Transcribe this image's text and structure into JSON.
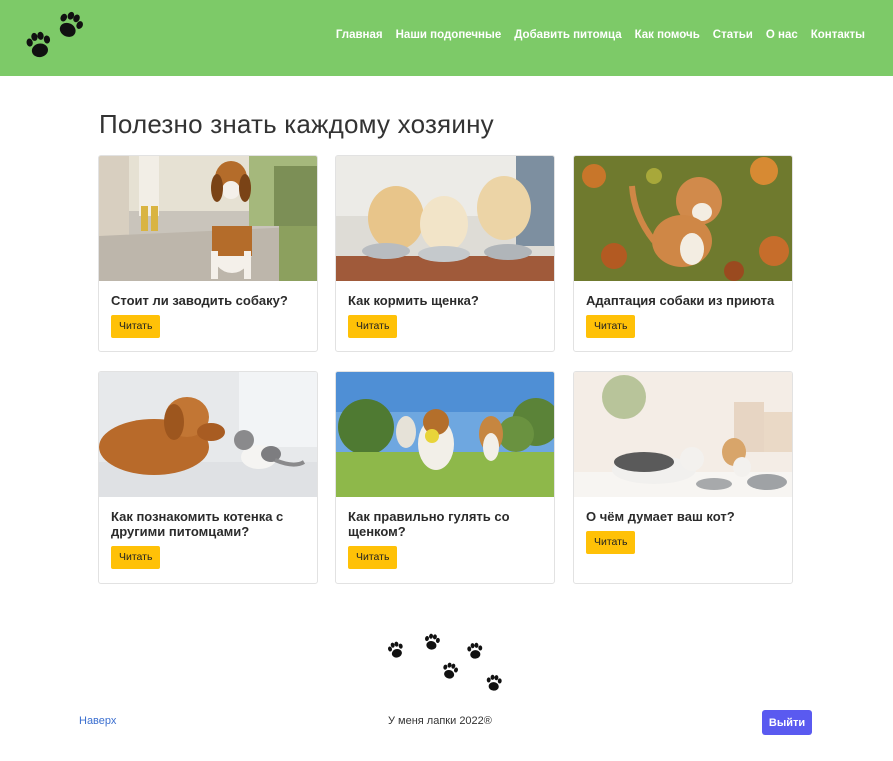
{
  "nav": {
    "logo_icon": "paw-prints-logo-icon",
    "links": [
      "Главная",
      "Наши подопечные",
      "Добавить питомца",
      "Как помочь",
      "Статьи",
      "О нас",
      "Контакты"
    ]
  },
  "main": {
    "title": "Полезно знать каждому хозяину",
    "cards": [
      {
        "title": "Стоит ли заводить собаку?",
        "button": "Читать",
        "image": "beagle-on-leash-photo"
      },
      {
        "title": "Как кормить щенка?",
        "button": "Читать",
        "image": "puppies-eating-photo"
      },
      {
        "title": "Адаптация собаки из приюта",
        "button": "Читать",
        "image": "puppy-in-leaves-photo"
      },
      {
        "title": "Как познакомить котенка с другими питомцами?",
        "button": "Читать",
        "image": "dog-and-kitten-photo"
      },
      {
        "title": "Как правильно гулять со щенком?",
        "button": "Читать",
        "image": "beagles-running-photo"
      },
      {
        "title": "О чём думает ваш кот?",
        "button": "Читать",
        "image": "kittens-eating-photo"
      }
    ]
  },
  "footer": {
    "paws_icon": "paw-prints-trail-icon",
    "top_link": "Наверх",
    "copyright": "У меня лапки 2022®",
    "logout": "Выйти"
  },
  "colors": {
    "navbar": "#7dca68",
    "button_yellow": "#ffc107",
    "logout_button": "#5a5af0",
    "link_blue": "#3b6fd0"
  }
}
